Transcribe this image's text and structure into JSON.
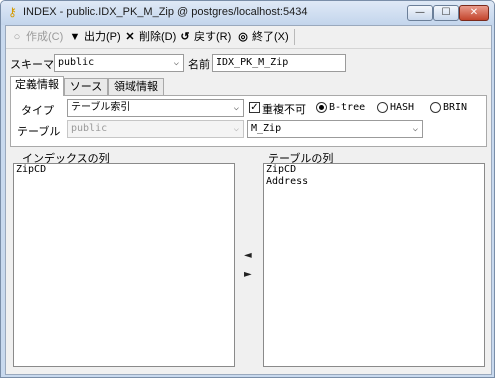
{
  "window": {
    "title": "INDEX - public.IDX_PK_M_Zip @ postgres/localhost:5434",
    "title_icon": "key-icon",
    "controls": {
      "minimize": "—",
      "maximize": "☐",
      "close": "✕"
    }
  },
  "toolbar": {
    "create": {
      "icon": "○",
      "label": "作成(C)",
      "enabled": false
    },
    "export": {
      "icon": "▼",
      "label": "出力(P)"
    },
    "delete": {
      "icon": "✕",
      "label": "削除(D)"
    },
    "revert": {
      "icon": "↺",
      "label": "戻す(R)"
    },
    "exit": {
      "icon": "◎",
      "label": "終了(X)"
    }
  },
  "form": {
    "schema_label": "スキーマ",
    "schema_value": "public",
    "name_label": "名前",
    "name_value": "IDX_PK_M_Zip"
  },
  "tabs": [
    {
      "label": "定義情報",
      "active": true
    },
    {
      "label": "ソース",
      "active": false
    },
    {
      "label": "領域情報",
      "active": false
    }
  ],
  "definition": {
    "type_label": "タイプ",
    "type_value": "テーブル索引",
    "unique_label": "重複不可",
    "unique_checked": true,
    "methods": [
      {
        "label": "B-tree",
        "selected": true
      },
      {
        "label": "HASH",
        "selected": false
      },
      {
        "label": "BRIN",
        "selected": false
      }
    ],
    "table_label": "テーブル",
    "table_schema_value": "public",
    "table_value": "M_Zip"
  },
  "index_columns": {
    "heading": "インデックスの列",
    "items": [
      "ZipCD"
    ]
  },
  "table_columns": {
    "heading": "テーブルの列",
    "items": [
      "ZipCD",
      "Address"
    ]
  },
  "move": {
    "left": "◄",
    "right": "►"
  },
  "combo_arrow": "⌵"
}
